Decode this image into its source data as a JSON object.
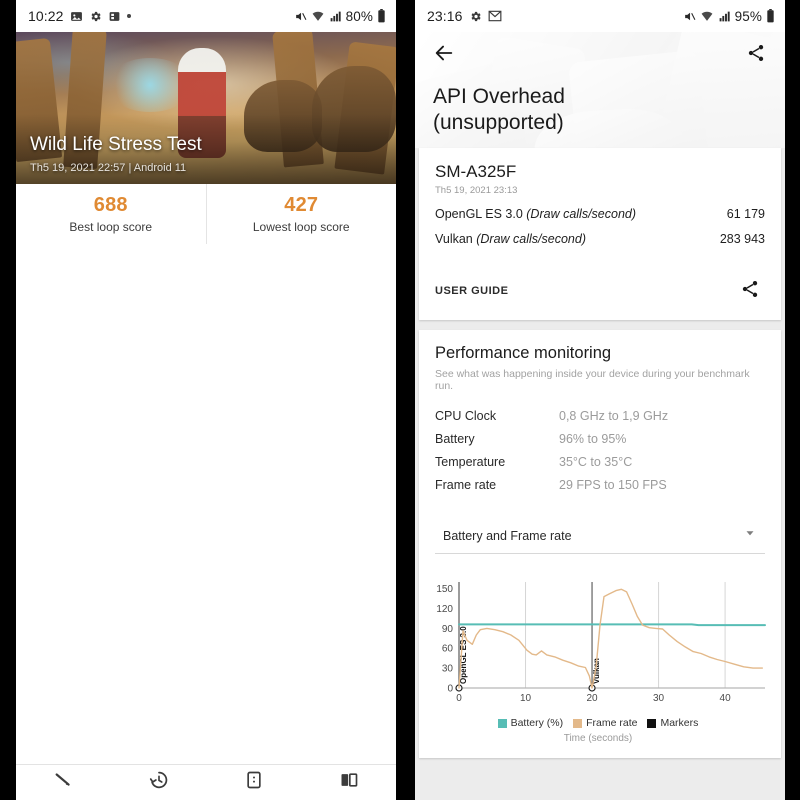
{
  "colors": {
    "accent_orange": "#e08a33",
    "frame_rate_line": "#e3b98a",
    "battery_line": "#57bdb5",
    "markers": "#111111",
    "card_bg": "#ffffff",
    "page_bg": "#ececec"
  },
  "left_screen": {
    "status_bar": {
      "time": "10:22",
      "icons": [
        "image-icon",
        "gear-icon",
        "screenshot-icon",
        "dot-icon"
      ],
      "right_icons": [
        "mute-icon",
        "wifi-icon",
        "signal-icon"
      ],
      "battery": "80%"
    },
    "banner": {
      "title": "Wild Life Stress Test",
      "subtitle": "Th5 19, 2021 22:57 | Android 11"
    },
    "scores": [
      {
        "value": "688",
        "label": "Best loop score"
      },
      {
        "value": "427",
        "label": "Lowest loop score"
      }
    ],
    "bottom_nav": [
      {
        "icon": "benchmark-icon",
        "name": "nav-benchmarks"
      },
      {
        "icon": "history-icon",
        "name": "nav-history"
      },
      {
        "icon": "device-icon",
        "name": "nav-device"
      },
      {
        "icon": "compare-icon",
        "name": "nav-compare"
      }
    ]
  },
  "right_screen": {
    "status_bar": {
      "time": "23:16",
      "icons": [
        "gear-icon",
        "mail-icon"
      ],
      "right_icons": [
        "mute-icon",
        "wifi-icon",
        "signal-icon"
      ],
      "battery": "95%"
    },
    "header": {
      "back_icon": "back-arrow-icon",
      "share_icon": "share-icon",
      "title_line1": "API Overhead",
      "title_line2": "(unsupported)"
    },
    "result_card": {
      "device": "SM-A325F",
      "date": "Th5 19, 2021 23:13",
      "metrics": [
        {
          "name": "OpenGL ES 3.0 ",
          "unit": "(Draw calls/second)",
          "value": "61 179"
        },
        {
          "name": "Vulkan ",
          "unit": "(Draw calls/second)",
          "value": "283 943"
        }
      ],
      "user_guide_label": "USER GUIDE",
      "share_icon": "share-icon"
    },
    "performance_card": {
      "title": "Performance monitoring",
      "subtitle": "See what was happening inside your device during your benchmark run.",
      "rows": [
        {
          "key": "CPU Clock",
          "value": "0,8 GHz to 1,9 GHz"
        },
        {
          "key": "Battery",
          "value": "96% to 95%"
        },
        {
          "key": "Temperature",
          "value": "35°C to 35°C"
        },
        {
          "key": "Frame rate",
          "value": "29 FPS to 150 FPS"
        }
      ],
      "dropdown": {
        "selected": "Battery and Frame rate",
        "chevron_icon": "chevron-down-icon"
      }
    }
  },
  "chart_data": {
    "type": "line",
    "title": "",
    "xlabel": "Time (seconds)",
    "ylabel": "",
    "xlim": [
      0,
      46
    ],
    "ylim": [
      0,
      160
    ],
    "xticks": [
      0,
      10,
      20,
      30,
      40
    ],
    "yticks": [
      0,
      30,
      60,
      90,
      120,
      150
    ],
    "grid": true,
    "legend_position": "bottom",
    "legend": [
      {
        "name": "Battery (%)",
        "color": "#57bdb5"
      },
      {
        "name": "Frame rate",
        "color": "#e3b98a"
      },
      {
        "name": "Markers",
        "color": "#111111"
      }
    ],
    "markers": [
      {
        "x": 0,
        "label": "OpenGL ES 3.0"
      },
      {
        "x": 20,
        "label": "Vulkan"
      }
    ],
    "series": [
      {
        "name": "Battery (%)",
        "color": "#57bdb5",
        "x": [
          0,
          10,
          20,
          30,
          35,
          36,
          40,
          46
        ],
        "values": [
          96,
          96,
          96,
          96,
          96,
          95,
          95,
          95
        ]
      },
      {
        "name": "Frame rate",
        "color": "#e3b98a",
        "x": [
          0,
          0.6,
          1.2,
          2.0,
          2.6,
          3.2,
          4.2,
          5.4,
          6.6,
          7.8,
          9.0,
          10.2,
          11.0,
          11.6,
          12.4,
          13.2,
          14.4,
          15.6,
          16.8,
          18.0,
          19.0,
          19.6,
          20.0,
          20.6,
          21.2,
          21.8,
          22.6,
          23.6,
          24.4,
          25.2,
          26.0,
          26.8,
          27.6,
          28.6,
          29.6,
          30.6,
          31.6,
          32.8,
          34.0,
          35.2,
          36.4,
          37.6,
          38.8,
          40.0,
          41.4,
          42.8,
          44.2,
          45.6
        ],
        "values": [
          0,
          86,
          72,
          66,
          80,
          88,
          90,
          88,
          85,
          80,
          72,
          57,
          51,
          50,
          56,
          50,
          47,
          42,
          38,
          33,
          31,
          18,
          0,
          30,
          95,
          138,
          142,
          147,
          149,
          145,
          127,
          108,
          95,
          91,
          90,
          89,
          80,
          70,
          62,
          55,
          52,
          47,
          43,
          40,
          36,
          32,
          30,
          30
        ]
      }
    ]
  }
}
